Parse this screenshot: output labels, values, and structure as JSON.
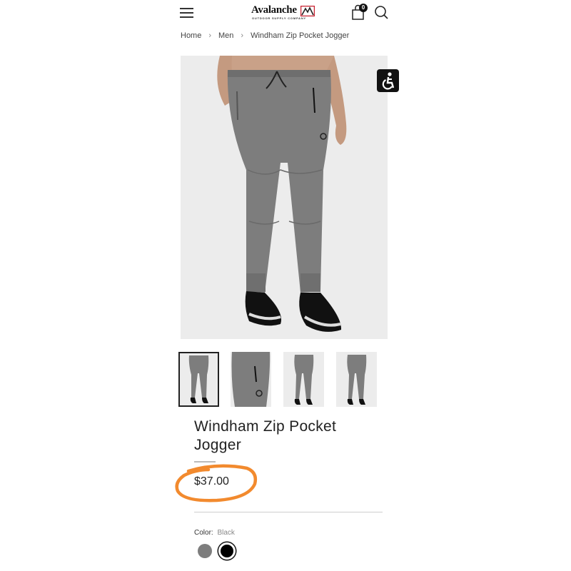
{
  "header": {
    "menu_icon": "hamburger-menu-icon",
    "logo": {
      "name": "Avalanche",
      "tagline": "OUTDOOR SUPPLY COMPANY",
      "accent": "#c8202f"
    },
    "cart_count": "0",
    "cart_icon": "shopping-bag-icon",
    "search_icon": "search-icon"
  },
  "breadcrumb": [
    "Home",
    "Men",
    "Windham Zip Pocket Jogger"
  ],
  "product": {
    "title": "Windham Zip Pocket Jogger",
    "price": "$37.00",
    "color_label": "Color:",
    "color_value": "Black",
    "swatches": [
      {
        "name": "Grey",
        "hex": "#7d7d7d"
      },
      {
        "name": "Black",
        "hex": "#000000",
        "selected": true
      }
    ]
  },
  "annotation": {
    "highlight_color": "#f28a2e",
    "target": "price"
  },
  "gallery": {
    "thumbnail_count": 4,
    "active_index": 0
  }
}
